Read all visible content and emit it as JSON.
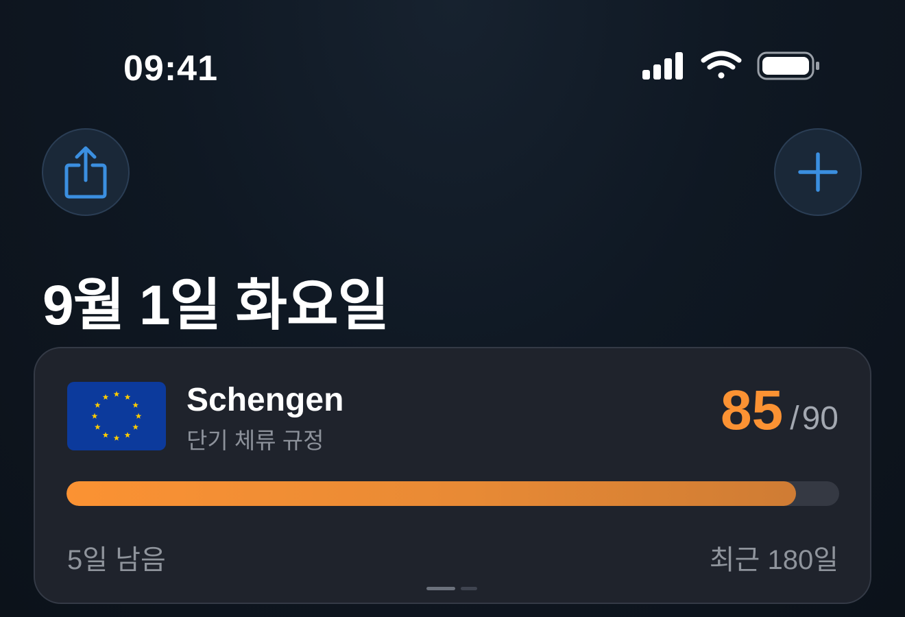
{
  "status_bar": {
    "time": "09:41",
    "icons": [
      "cellular-signal-icon",
      "wifi-icon",
      "battery-icon"
    ]
  },
  "toolbar": {
    "share_icon": "share-icon",
    "add_icon": "plus-icon"
  },
  "header": {
    "title": "9월 1일 화요일"
  },
  "card": {
    "flag_icon": "eu-flag-icon",
    "region_name": "Schengen",
    "region_description": "단기 체류 규정",
    "days_used": "85",
    "separator": "/",
    "days_limit": "90",
    "progress_fraction": 0.944,
    "remaining_label": "5일 남음",
    "window_label": "최근 180일",
    "page_count": 2,
    "active_page": 1
  },
  "colors": {
    "accent_orange": "#fb9233",
    "accent_blue": "#3b8fe0",
    "card_background": "#1f232c",
    "eu_blue": "#0c3a9c",
    "eu_star": "#ffcc00"
  }
}
